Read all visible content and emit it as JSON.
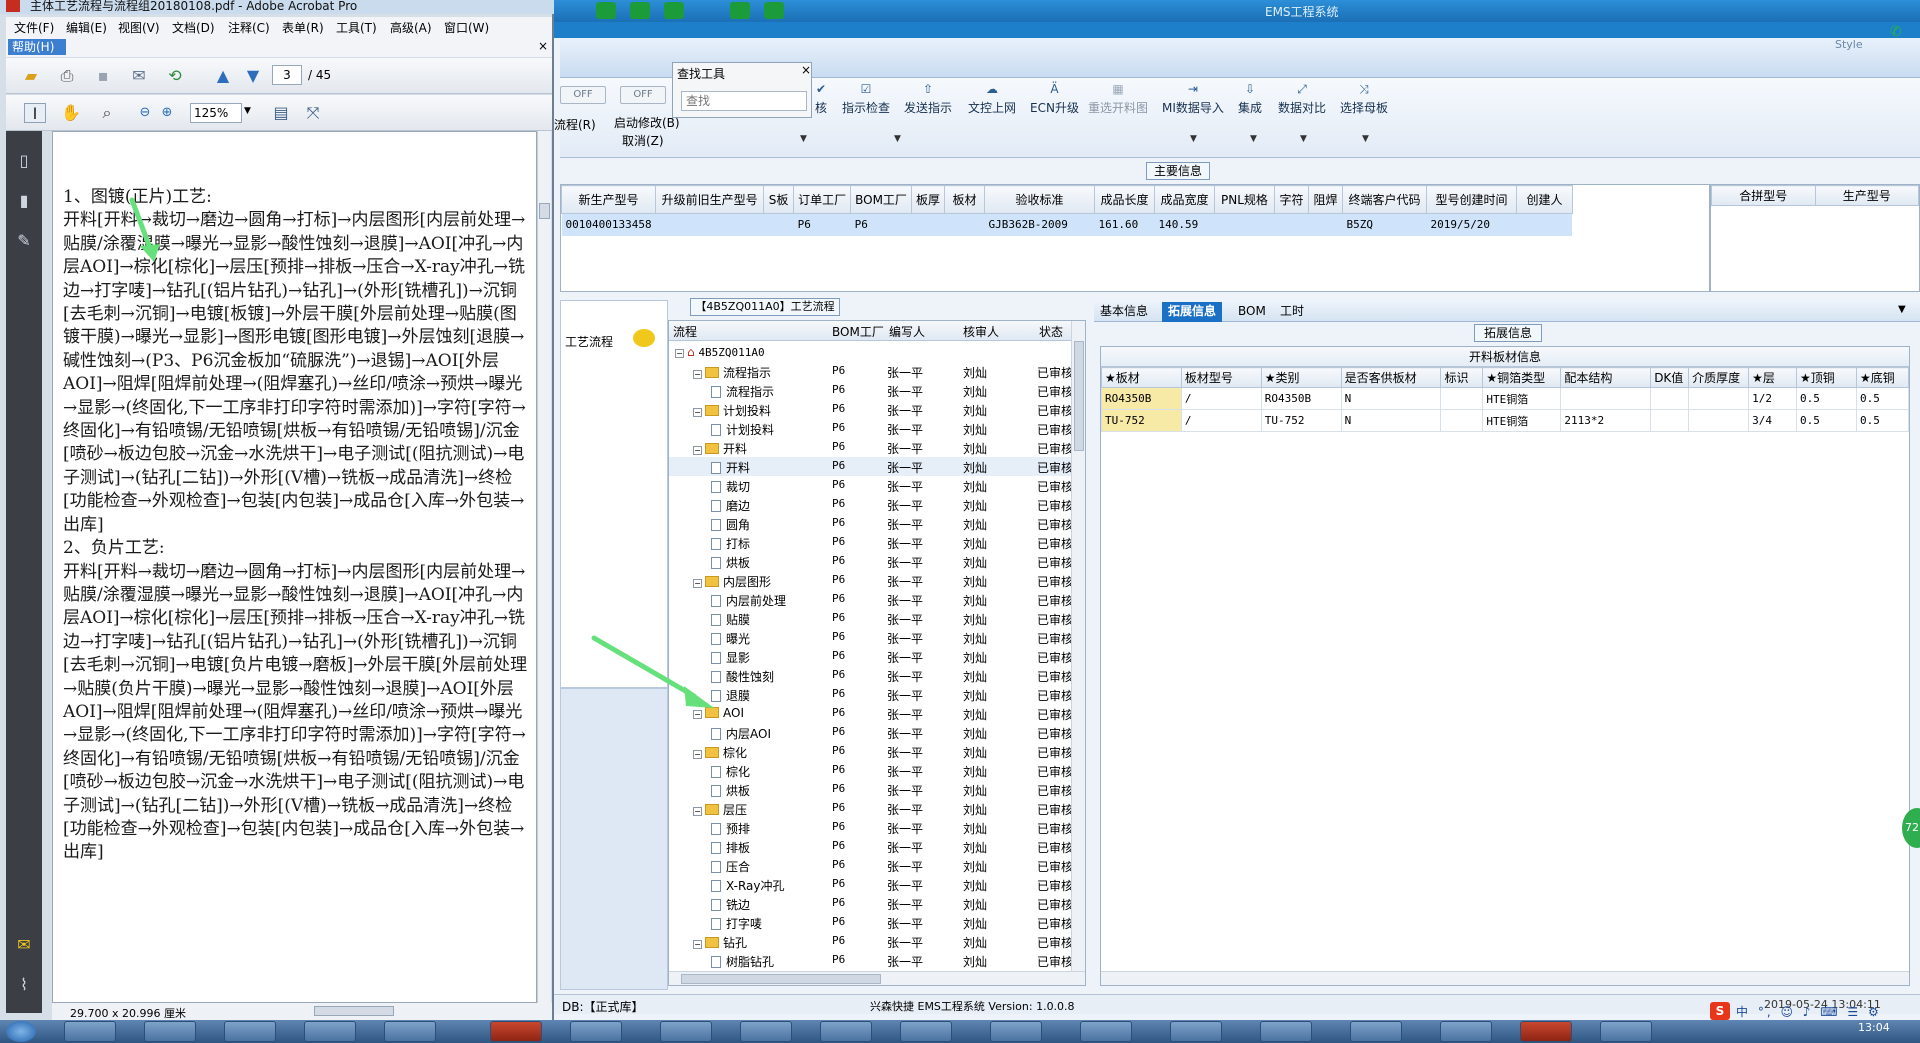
{
  "ems": {
    "title": "EMS工程系统",
    "style_label": "Style",
    "toolbar_left": {
      "off1": "OFF",
      "off2": "OFF",
      "flow": "流程(R)",
      "start_modify": "启动修改(B)",
      "cancel": "取消(Z)"
    },
    "toolbar_buttons": [
      {
        "label": "核",
        "icon": "check-icon"
      },
      {
        "label": "指示检查",
        "icon": "check-icon"
      },
      {
        "label": "发送指示",
        "icon": "upload-icon"
      },
      {
        "label": "文控上网",
        "icon": "cloud-upload-icon"
      },
      {
        "label": "ECN升级",
        "icon": "upgrade-icon"
      },
      {
        "label": "重选开料图",
        "icon": "image-icon"
      },
      {
        "label": "MI数据导入",
        "icon": "import-icon"
      },
      {
        "label": "集成",
        "icon": "download-icon"
      },
      {
        "label": "数据对比",
        "icon": "compare-icon"
      },
      {
        "label": "选择母板",
        "icon": "shuffle-icon"
      }
    ],
    "find_tool": {
      "title": "查找工具",
      "placeholder": "查找"
    },
    "main_info": {
      "caption": "主要信息",
      "columns": [
        "新生产型号",
        "升级前旧生产型号",
        "S板",
        "订单工厂",
        "BOM工厂",
        "板厚",
        "板材",
        "验收标准",
        "成品长度",
        "成品宽度",
        "PNL规格",
        "字符",
        "阻焊",
        "终端客户代码",
        "型号创建时间",
        "创建人"
      ],
      "row": [
        "0010400133458",
        "",
        "",
        "P6",
        "P6",
        "",
        "",
        "GJB362B-2009",
        "161.60",
        "140.59",
        "",
        "",
        "",
        "B5ZQ",
        "2019/5/20",
        ""
      ],
      "merge_columns": [
        "合拼型号",
        "生产型号"
      ]
    },
    "flow": {
      "left_label": "工艺流程",
      "caption": "【4B5ZQ011A0】工艺流程",
      "columns": [
        "流程",
        "BOM工厂",
        "编写人",
        "核审人",
        "状态"
      ],
      "rows": [
        {
          "name": "4B5ZQ011A0",
          "level": 0,
          "type": "root",
          "bom": "",
          "writer": "",
          "reviewer": "",
          "status": ""
        },
        {
          "name": "流程指示",
          "level": 1,
          "type": "folder",
          "bom": "P6",
          "writer": "张一平",
          "reviewer": "刘灿",
          "status": "已审核"
        },
        {
          "name": "流程指示",
          "level": 2,
          "type": "doc",
          "bom": "P6",
          "writer": "张一平",
          "reviewer": "刘灿",
          "status": "已审核"
        },
        {
          "name": "计划投料",
          "level": 1,
          "type": "folder",
          "bom": "P6",
          "writer": "张一平",
          "reviewer": "刘灿",
          "status": "已审核"
        },
        {
          "name": "计划投料",
          "level": 2,
          "type": "doc",
          "bom": "P6",
          "writer": "张一平",
          "reviewer": "刘灿",
          "status": "已审核"
        },
        {
          "name": "开料",
          "level": 1,
          "type": "folder",
          "bom": "P6",
          "writer": "张一平",
          "reviewer": "刘灿",
          "status": "已审核"
        },
        {
          "name": "开料",
          "level": 2,
          "type": "doc",
          "bom": "P6",
          "writer": "张一平",
          "reviewer": "刘灿",
          "status": "已审核",
          "hl": true
        },
        {
          "name": "裁切",
          "level": 2,
          "type": "doc",
          "bom": "P6",
          "writer": "张一平",
          "reviewer": "刘灿",
          "status": "已审核"
        },
        {
          "name": "磨边",
          "level": 2,
          "type": "doc",
          "bom": "P6",
          "writer": "张一平",
          "reviewer": "刘灿",
          "status": "已审核"
        },
        {
          "name": "圆角",
          "level": 2,
          "type": "doc",
          "bom": "P6",
          "writer": "张一平",
          "reviewer": "刘灿",
          "status": "已审核"
        },
        {
          "name": "打标",
          "level": 2,
          "type": "doc",
          "bom": "P6",
          "writer": "张一平",
          "reviewer": "刘灿",
          "status": "已审核"
        },
        {
          "name": "烘板",
          "level": 2,
          "type": "doc",
          "bom": "P6",
          "writer": "张一平",
          "reviewer": "刘灿",
          "status": "已审核"
        },
        {
          "name": "内层图形",
          "level": 1,
          "type": "folder",
          "bom": "P6",
          "writer": "张一平",
          "reviewer": "刘灿",
          "status": "已审核"
        },
        {
          "name": "内层前处理",
          "level": 2,
          "type": "doc",
          "bom": "P6",
          "writer": "张一平",
          "reviewer": "刘灿",
          "status": "已审核"
        },
        {
          "name": "贴膜",
          "level": 2,
          "type": "doc",
          "bom": "P6",
          "writer": "张一平",
          "reviewer": "刘灿",
          "status": "已审核"
        },
        {
          "name": "曝光",
          "level": 2,
          "type": "doc",
          "bom": "P6",
          "writer": "张一平",
          "reviewer": "刘灿",
          "status": "已审核"
        },
        {
          "name": "显影",
          "level": 2,
          "type": "doc",
          "bom": "P6",
          "writer": "张一平",
          "reviewer": "刘灿",
          "status": "已审核"
        },
        {
          "name": "酸性蚀刻",
          "level": 2,
          "type": "doc",
          "bom": "P6",
          "writer": "张一平",
          "reviewer": "刘灿",
          "status": "已审核"
        },
        {
          "name": "退膜",
          "level": 2,
          "type": "doc",
          "bom": "P6",
          "writer": "张一平",
          "reviewer": "刘灿",
          "status": "已审核"
        },
        {
          "name": "AOI",
          "level": 1,
          "type": "folder",
          "bom": "P6",
          "writer": "张一平",
          "reviewer": "刘灿",
          "status": "已审核"
        },
        {
          "name": "内层AOI",
          "level": 2,
          "type": "doc",
          "bom": "P6",
          "writer": "张一平",
          "reviewer": "刘灿",
          "status": "已审核"
        },
        {
          "name": "棕化",
          "level": 1,
          "type": "folder",
          "bom": "P6",
          "writer": "张一平",
          "reviewer": "刘灿",
          "status": "已审核"
        },
        {
          "name": "棕化",
          "level": 2,
          "type": "doc",
          "bom": "P6",
          "writer": "张一平",
          "reviewer": "刘灿",
          "status": "已审核"
        },
        {
          "name": "烘板",
          "level": 2,
          "type": "doc",
          "bom": "P6",
          "writer": "张一平",
          "reviewer": "刘灿",
          "status": "已审核"
        },
        {
          "name": "层压",
          "level": 1,
          "type": "folder",
          "bom": "P6",
          "writer": "张一平",
          "reviewer": "刘灿",
          "status": "已审核"
        },
        {
          "name": "预排",
          "level": 2,
          "type": "doc",
          "bom": "P6",
          "writer": "张一平",
          "reviewer": "刘灿",
          "status": "已审核"
        },
        {
          "name": "排板",
          "level": 2,
          "type": "doc",
          "bom": "P6",
          "writer": "张一平",
          "reviewer": "刘灿",
          "status": "已审核"
        },
        {
          "name": "压合",
          "level": 2,
          "type": "doc",
          "bom": "P6",
          "writer": "张一平",
          "reviewer": "刘灿",
          "status": "已审核"
        },
        {
          "name": "X-Ray冲孔",
          "level": 2,
          "type": "doc",
          "bom": "P6",
          "writer": "张一平",
          "reviewer": "刘灿",
          "status": "已审核"
        },
        {
          "name": "铣边",
          "level": 2,
          "type": "doc",
          "bom": "P6",
          "writer": "张一平",
          "reviewer": "刘灿",
          "status": "已审核"
        },
        {
          "name": "打字唛",
          "level": 2,
          "type": "doc",
          "bom": "P6",
          "writer": "张一平",
          "reviewer": "刘灿",
          "status": "已审核"
        },
        {
          "name": "钻孔",
          "level": 1,
          "type": "folder",
          "bom": "P6",
          "writer": "张一平",
          "reviewer": "刘灿",
          "status": "已审核"
        },
        {
          "name": "树脂钻孔",
          "level": 2,
          "type": "doc",
          "bom": "P6",
          "writer": "张一平",
          "reviewer": "刘灿",
          "status": "已审核"
        }
      ]
    },
    "right_tabs": [
      "基本信息",
      "拓展信息",
      "BOM",
      "工时"
    ],
    "ext_info": {
      "caption": "拓展信息",
      "table_title": "开料板材信息",
      "columns": [
        "★板材",
        "板材型号",
        "★类别",
        "是否客供板材",
        "标识",
        "★铜箔类型",
        "配本结构",
        "DK值",
        "介质厚度",
        "★层",
        "★顶铜",
        "★底铜"
      ],
      "rows": [
        [
          "RO4350B",
          "/",
          "RO4350B",
          "N",
          "",
          "HTE铜箔",
          "",
          "",
          "",
          "1/2",
          "0.5",
          "0.5"
        ],
        [
          "TU-752",
          "/",
          "TU-752",
          "N",
          "",
          "HTE铜箔",
          "2113*2",
          "",
          "",
          "3/4",
          "0.5",
          "0.5"
        ]
      ]
    },
    "status": {
      "db": "DB:【正式库】",
      "version": "兴森快捷 EMS工程系统 Version: 1.0.0.8",
      "time": "2019-05-24 13:04:11"
    },
    "ime": "中 °, ☺ ♪ ⌨ ☰ ⚙",
    "side_circle": "72"
  },
  "acrobat": {
    "title": "主体工艺流程与流程组20180108.pdf - Adobe Acrobat Pro",
    "menus": [
      "文件(F)",
      "编辑(E)",
      "视图(V)",
      "文档(D)",
      "注释(C)",
      "表单(R)",
      "工具(T)",
      "高级(A)",
      "窗口(W)"
    ],
    "help_menu": "帮助(H)",
    "page_current": "3",
    "page_total": "/ 45",
    "zoom": "125%",
    "page_size": "29.700 x 20.996 厘米",
    "doc_paragraphs": [
      "1、图镀(正片)工艺:",
      "开料[开料→裁切→磨边→圆角→打标]→内层图形[内层前处理→贴膜/涂覆湿膜→曝光→显影→酸性蚀刻→退膜]→AOI[冲孔→内层AOI]→棕化[棕化]→层压[预排→排板→压合→X-ray冲孔→铣边→打字唛]→钻孔[(铝片钻孔)→钻孔]→(外形[铣槽孔])→沉铜[去毛刺→沉铜]→电镀[板镀]→外层干膜[外层前处理→贴膜(图镀干膜)→曝光→显影]→图形电镀[图形电镀]→外层蚀刻[退膜→碱性蚀刻→(P3、P6沉金板加“硫脲洗”)→退锡]→AOI[外层AOI]→阻焊[阻焊前处理→(阻焊塞孔)→丝印/喷涂→预烘→曝光→显影→(终固化,下一工序非打印字符时需添加)]→字符[字符→终固化]→有铅喷锡/无铅喷锡[烘板→有铅喷锡/无铅喷锡]/沉金[喷砂→板边包胶→沉金→水洗烘干]→电子测试[(阻抗测试)→电子测试]→(钻孔[二钻])→外形[(V槽)→铣板→成品清洗]→终检[功能检查→外观检查]→包装[内包装]→成品仓[入库→外包装→出库]",
      "2、负片工艺:",
      "开料[开料→裁切→磨边→圆角→打标]→内层图形[内层前处理→贴膜/涂覆湿膜→曝光→显影→酸性蚀刻→退膜]→AOI[冲孔→内层AOI]→棕化[棕化]→层压[预排→排板→压合→X-ray冲孔→铣边→打字唛]→钻孔[(铝片钻孔)→钻孔]→(外形[铣槽孔])→沉铜[去毛刺→沉铜]→电镀[负片电镀→磨板]→外层干膜[外层前处理→贴膜(负片干膜)→曝光→显影→酸性蚀刻→退膜]→AOI[外层AOI]→阻焊[阻焊前处理→(阻焊塞孔)→丝印/喷涂→预烘→曝光→显影→(终固化,下一工序非打印字符时需添加)]→字符[字符→终固化]→有铅喷锡/无铅喷锡[烘板→有铅喷锡/无铅喷锡]/沉金[喷砂→板边包胶→沉金→水洗烘干]→电子测试[(阻抗测试)→电子测试]→(钻孔[二钻])→外形[(V槽)→铣板→成品清洗]→终检[功能检查→外观检查]→包装[内包装]→成品仓[入库→外包装→出库]"
    ]
  },
  "taskbar": {
    "clock": "13:04"
  }
}
